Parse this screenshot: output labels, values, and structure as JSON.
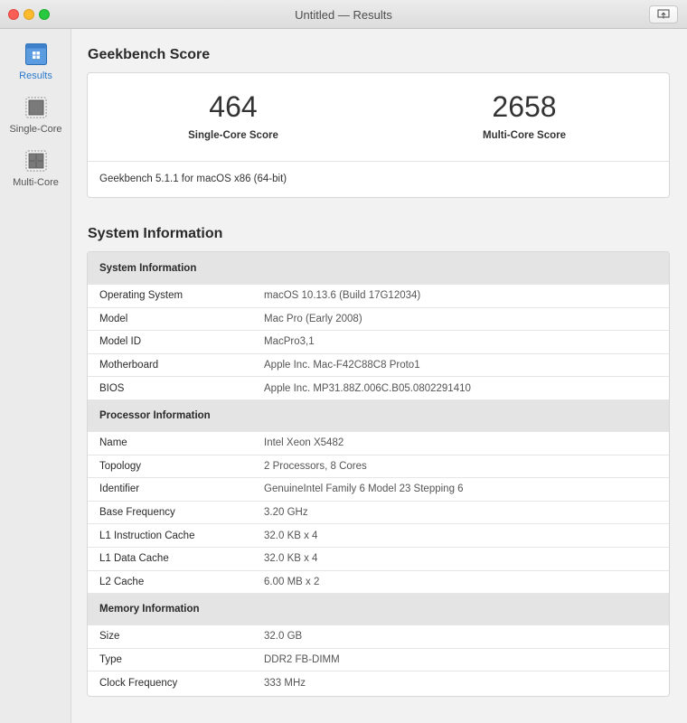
{
  "window": {
    "title": "Untitled — Results"
  },
  "sidebar": {
    "items": [
      {
        "label": "Results",
        "icon": "results-icon",
        "active": true
      },
      {
        "label": "Single-Core",
        "icon": "single-core-icon",
        "active": false
      },
      {
        "label": "Multi-Core",
        "icon": "multi-core-icon",
        "active": false
      }
    ]
  },
  "score": {
    "title": "Geekbench Score",
    "single_value": "464",
    "single_label": "Single-Core Score",
    "multi_value": "2658",
    "multi_label": "Multi-Core Score",
    "version": "Geekbench 5.1.1 for macOS x86 (64-bit)"
  },
  "system": {
    "title": "System Information",
    "sections": [
      {
        "header": "System Information",
        "rows": [
          {
            "key": "Operating System",
            "value": "macOS 10.13.6 (Build 17G12034)"
          },
          {
            "key": "Model",
            "value": "Mac Pro (Early 2008)"
          },
          {
            "key": "Model ID",
            "value": "MacPro3,1"
          },
          {
            "key": "Motherboard",
            "value": "Apple Inc. Mac-F42C88C8 Proto1"
          },
          {
            "key": "BIOS",
            "value": "Apple Inc. MP31.88Z.006C.B05.0802291410"
          }
        ]
      },
      {
        "header": "Processor Information",
        "rows": [
          {
            "key": "Name",
            "value": "Intel Xeon X5482"
          },
          {
            "key": "Topology",
            "value": "2 Processors, 8 Cores"
          },
          {
            "key": "Identifier",
            "value": "GenuineIntel Family 6 Model 23 Stepping 6"
          },
          {
            "key": "Base Frequency",
            "value": "3.20 GHz"
          },
          {
            "key": "L1 Instruction Cache",
            "value": "32.0 KB x 4"
          },
          {
            "key": "L1 Data Cache",
            "value": "32.0 KB x 4"
          },
          {
            "key": "L2 Cache",
            "value": "6.00 MB x 2"
          }
        ]
      },
      {
        "header": "Memory Information",
        "rows": [
          {
            "key": "Size",
            "value": "32.0 GB"
          },
          {
            "key": "Type",
            "value": "DDR2 FB-DIMM"
          },
          {
            "key": "Clock Frequency",
            "value": "333 MHz"
          }
        ]
      }
    ]
  },
  "colors": {
    "accent": "#2a7bd0",
    "header_bg": "#e4e4e4"
  }
}
